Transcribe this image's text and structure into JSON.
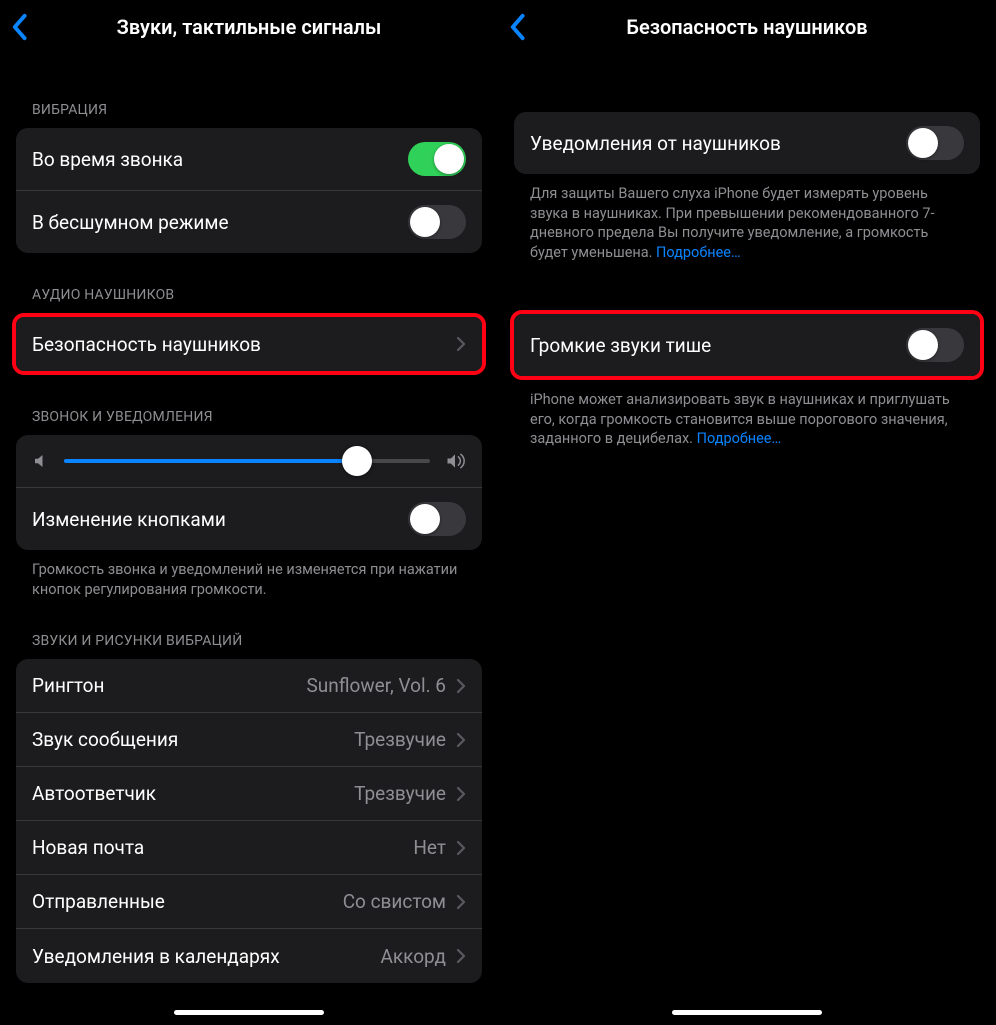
{
  "left": {
    "title": "Звуки, тактильные сигналы",
    "sections": {
      "vibration": {
        "header": "ВИБРАЦИЯ",
        "rows": {
          "during_call": "Во время звонка",
          "silent_mode": "В бесшумном режиме"
        }
      },
      "headphone_audio": {
        "header": "АУДИО НАУШНИКОВ",
        "row": "Безопасность наушников"
      },
      "ringer": {
        "header": "ЗВОНОК И УВЕДОМЛЕНИЯ",
        "change_with_buttons": "Изменение кнопками",
        "note": "Громкость звонка и уведомлений не изменяется при нажатии кнопок регулирования громкости."
      },
      "sounds_patterns": {
        "header": "ЗВУКИ И РИСУНКИ ВИБРАЦИЙ",
        "rows": [
          {
            "label": "Рингтон",
            "value": "Sunflower, Vol. 6"
          },
          {
            "label": "Звук сообщения",
            "value": "Трезвучие"
          },
          {
            "label": "Автоответчик",
            "value": "Трезвучие"
          },
          {
            "label": "Новая почта",
            "value": "Нет"
          },
          {
            "label": "Отправленные",
            "value": "Со свистом"
          },
          {
            "label": "Уведомления в календарях",
            "value": "Аккорд"
          }
        ]
      }
    },
    "toggle_states": {
      "during_call": true,
      "silent_mode": false,
      "change_with_buttons": false
    },
    "slider_value_pct": 80
  },
  "right": {
    "title": "Безопасность наушников",
    "rows": {
      "notifications": "Уведомления от наушников",
      "loud_sounds": "Громкие звуки тише"
    },
    "toggle_states": {
      "notifications": false,
      "loud_sounds": false
    },
    "notes": {
      "n1": "Для защиты Вашего слуха iPhone будет измерять уровень звука в наушниках. При превышении рекомендованного 7-дневного предела Вы получите уведомление, а громкость будет уменьшена. ",
      "n2": "iPhone может анализировать звук в наушниках и приглушать его, когда громкость становится выше порогового значения, заданного в децибелах. ",
      "more": "Подробнее…"
    }
  }
}
